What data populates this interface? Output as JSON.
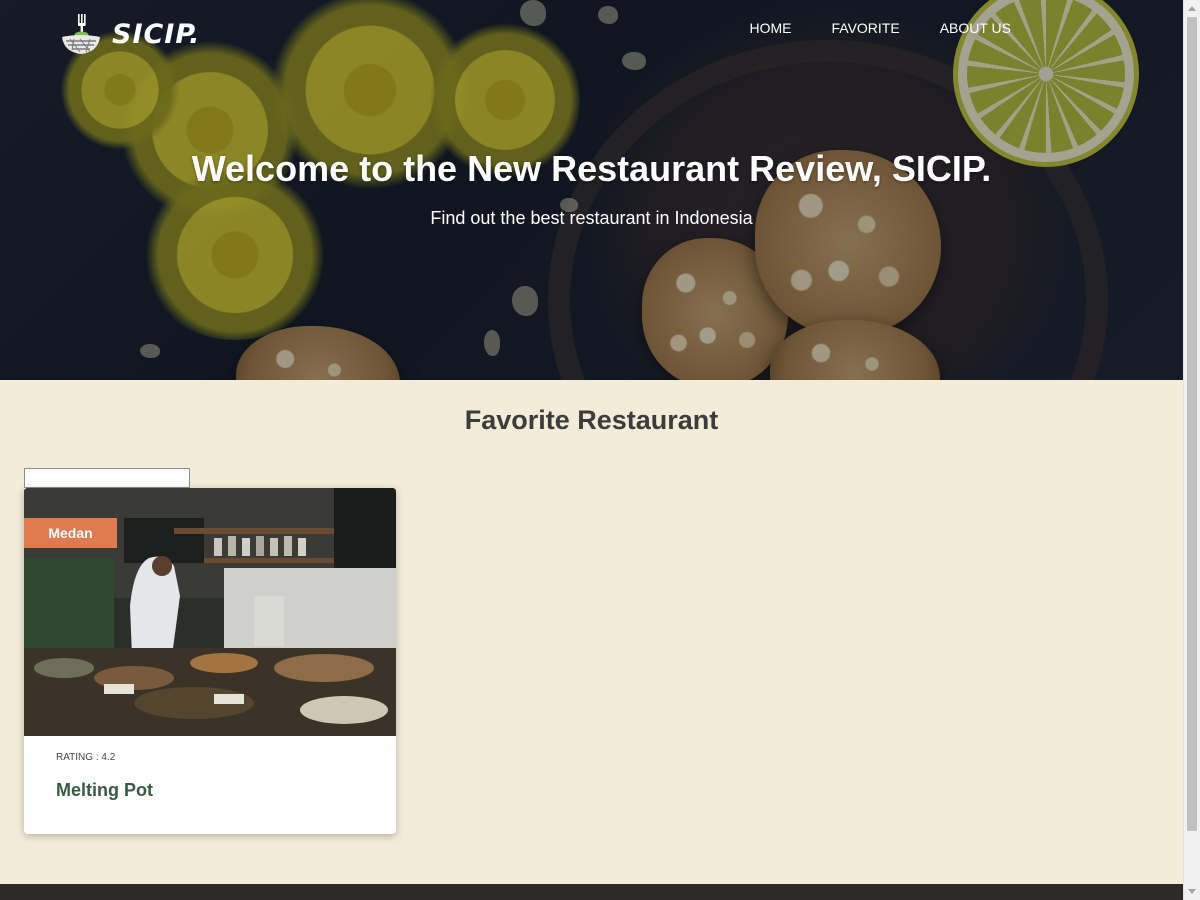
{
  "brand": {
    "name": "SICIP.",
    "logo_icon": "fork-bowl-icon"
  },
  "nav": {
    "items": [
      {
        "label": "HOME"
      },
      {
        "label": "FAVORITE"
      },
      {
        "label": "ABOUT US"
      }
    ]
  },
  "hero": {
    "title": "Welcome to the New Restaurant Review, SICIP.",
    "subtitle": "Find out the best restaurant in Indonesia"
  },
  "favorites": {
    "title": "Favorite Restaurant",
    "search": {
      "value": ""
    },
    "restaurants": [
      {
        "city": "Medan",
        "rating_text": "RATING : 4.2",
        "name": "Melting Pot"
      }
    ]
  },
  "colors": {
    "page_background": "#f2ecd8",
    "badge": "#e07b4f",
    "restaurant_name": "#375a45",
    "footer": "#2f2a2a"
  }
}
